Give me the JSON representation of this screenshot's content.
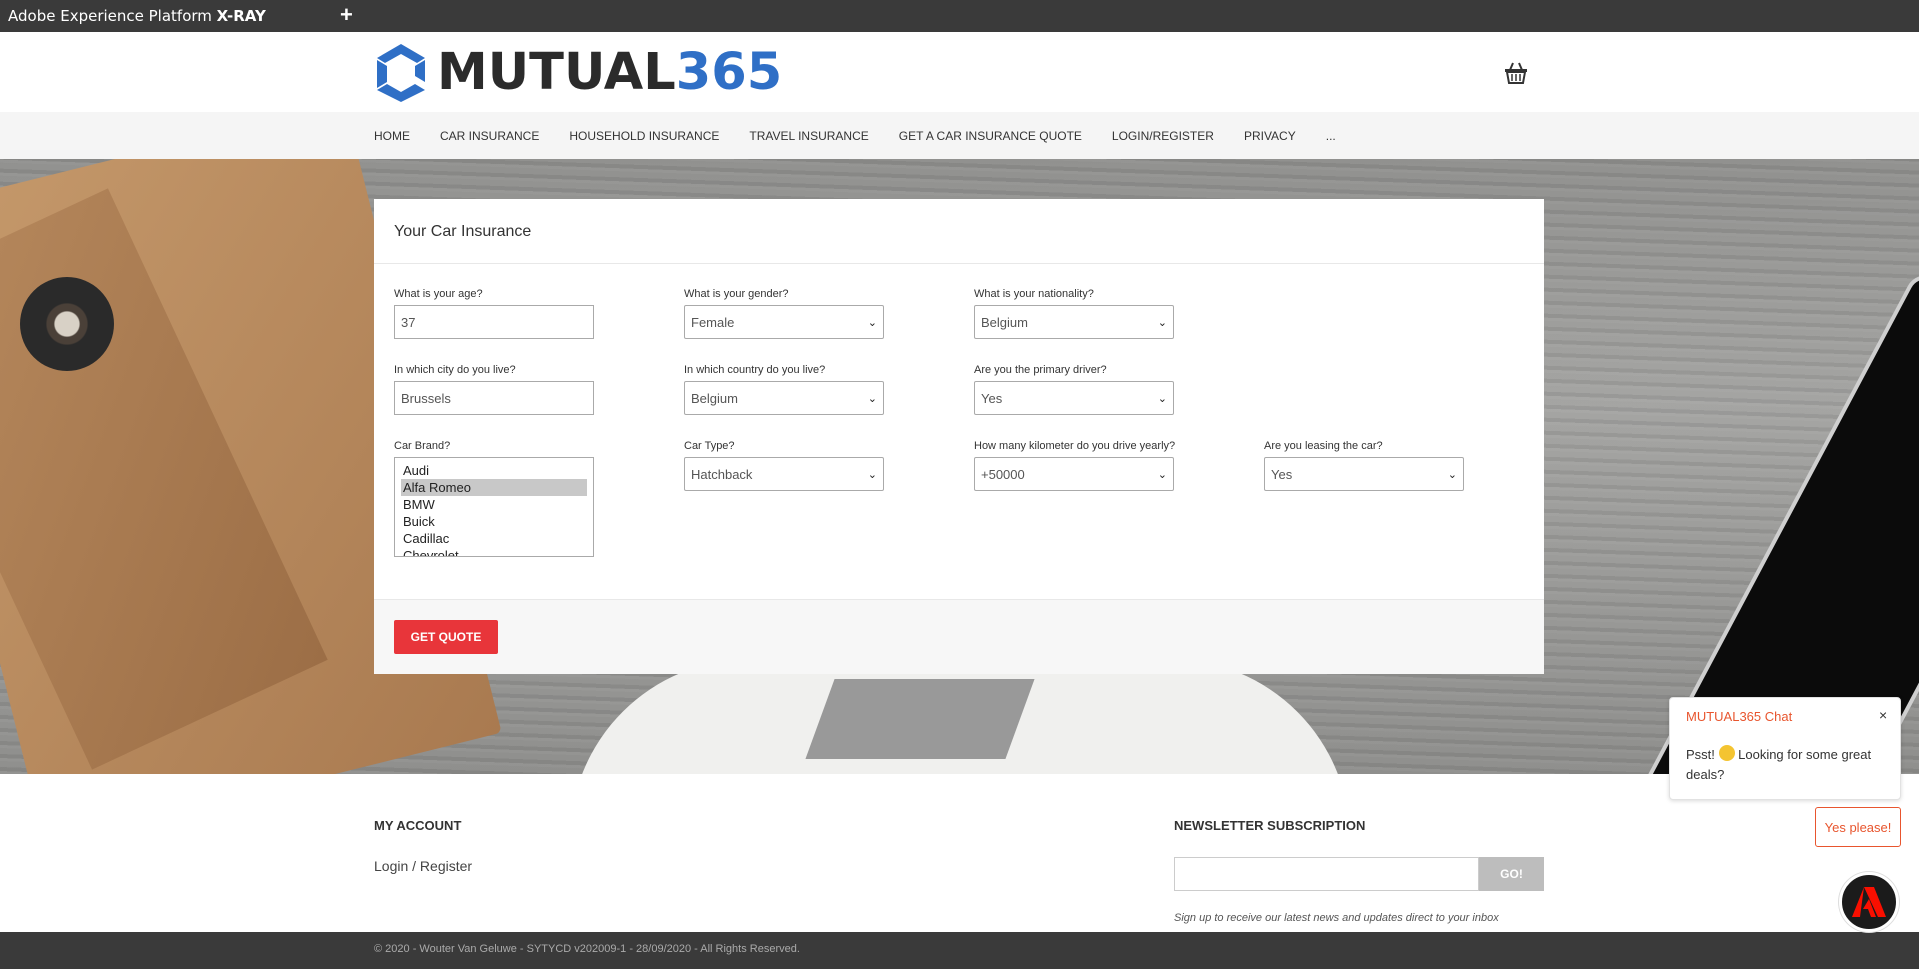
{
  "xray": {
    "title_prefix": "Adobe Experience Platform ",
    "title_bold": "X-RAY",
    "add_label": "+"
  },
  "brand": {
    "name_dark": "MUTUAL",
    "name_blue": "365"
  },
  "colors": {
    "accent_red": "#e8353a",
    "brand_blue": "#2f6fc6",
    "chat_orange": "#e8552e"
  },
  "nav": {
    "items": [
      "HOME",
      "CAR INSURANCE",
      "HOUSEHOLD INSURANCE",
      "TRAVEL INSURANCE",
      "GET A CAR INSURANCE QUOTE",
      "LOGIN/REGISTER",
      "PRIVACY",
      "..."
    ]
  },
  "form": {
    "title": "Your Car Insurance",
    "age": {
      "label": "What is your age?",
      "value": "37"
    },
    "gender": {
      "label": "What is your gender?",
      "value": "Female"
    },
    "nationality": {
      "label": "What is your nationality?",
      "value": "Belgium"
    },
    "city": {
      "label": "In which city do you live?",
      "value": "Brussels"
    },
    "country": {
      "label": "In which country do you live?",
      "value": "Belgium"
    },
    "primary_driver": {
      "label": "Are you the primary driver?",
      "value": "Yes"
    },
    "car_brand": {
      "label": "Car Brand?",
      "options": [
        "Audi",
        "Alfa Romeo",
        "BMW",
        "Buick",
        "Cadillac",
        "Chevrolet"
      ],
      "selected": "Alfa Romeo"
    },
    "car_type": {
      "label": "Car Type?",
      "value": "Hatchback"
    },
    "kilometers": {
      "label": "How many kilometer do you drive yearly?",
      "value": "+50000"
    },
    "leasing": {
      "label": "Are you leasing the car?",
      "value": "Yes"
    },
    "submit_label": "GET QUOTE"
  },
  "footer": {
    "account_heading": "MY ACCOUNT",
    "account_link": "Login / Register",
    "newsletter_heading": "NEWSLETTER SUBSCRIPTION",
    "newsletter_button": "GO!",
    "newsletter_note": "Sign up to receive our latest news and updates direct to your inbox",
    "copyright": "© 2020 - Wouter Van Geluwe - SYTYCD v202009-1 - 28/09/2020 - All Rights Reserved."
  },
  "chat": {
    "title": "MUTUAL365 Chat",
    "close": "×",
    "message_start": "Psst! ",
    "message_end": " Looking for some great deals?",
    "yes_label": "Yes please!"
  }
}
